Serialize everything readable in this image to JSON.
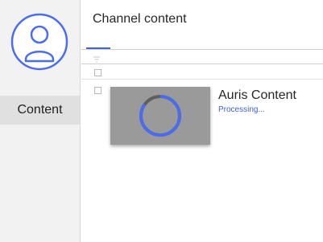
{
  "sidebar": {
    "avatar_icon": "user-avatar-icon",
    "items": [
      {
        "label": "Content",
        "selected": true
      }
    ]
  },
  "header": {
    "title": "Channel content"
  },
  "toolbar": {
    "filter_icon": "filter-icon"
  },
  "list": {
    "items": [
      {
        "title": "Auris Content",
        "status": "Processing..."
      }
    ]
  },
  "colors": {
    "accent": "#3d63dd",
    "sidebar_bg": "#f2f2f2",
    "selected_bg": "#e0e0e0",
    "thumb_bg": "#9a9a9a"
  }
}
